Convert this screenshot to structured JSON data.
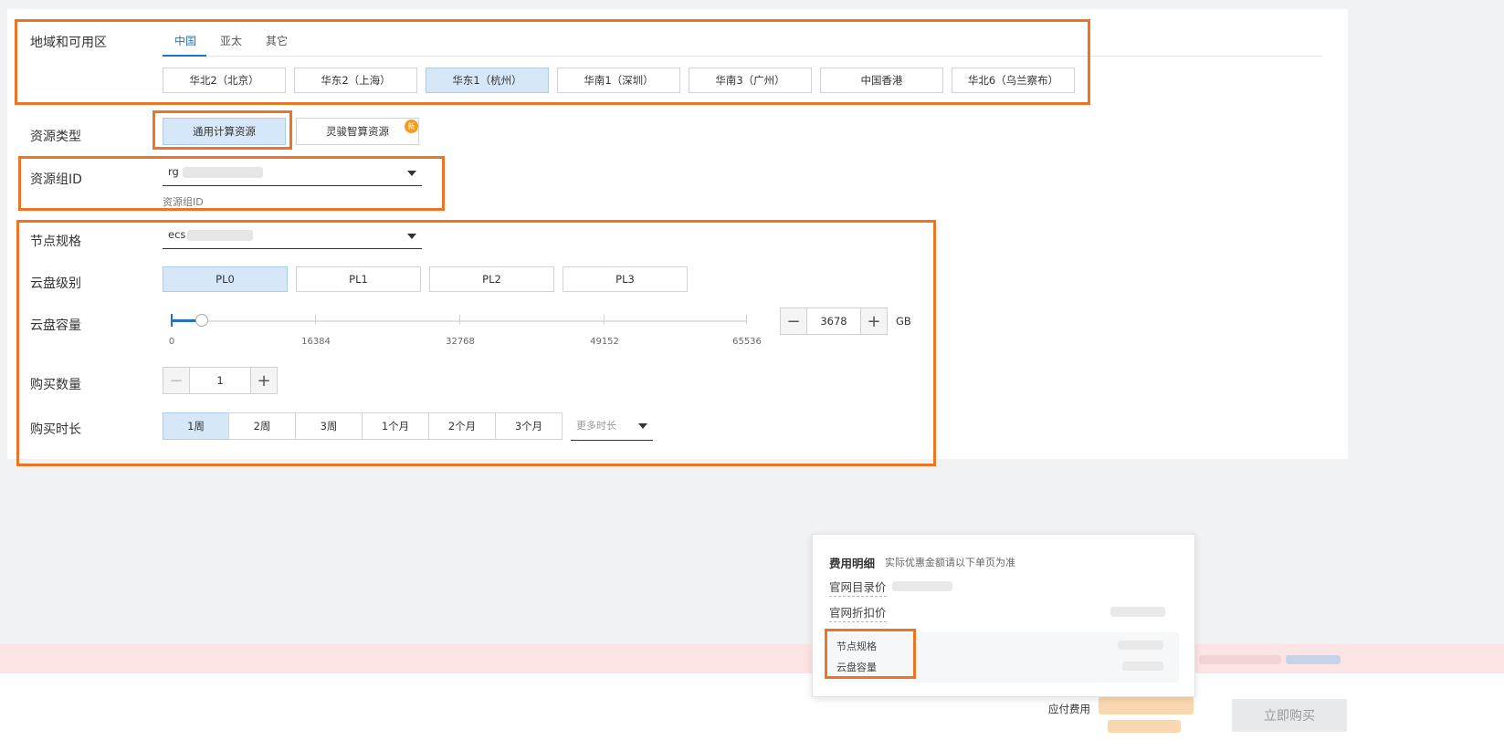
{
  "region": {
    "label": "地域和可用区",
    "tabs": [
      "中国",
      "亚太",
      "其它"
    ],
    "active_tab": "中国",
    "zones": [
      "华北2（北京）",
      "华东2（上海）",
      "华东1（杭州）",
      "华南1（深圳）",
      "华南3（广州）",
      "中国香港",
      "华北6（乌兰察布）"
    ],
    "selected_zone": "华东1（杭州）"
  },
  "resource_type": {
    "label": "资源类型",
    "options": [
      "通用计算资源",
      "灵骏智算资源"
    ],
    "selected": "通用计算资源",
    "new_badge": "新"
  },
  "resource_group": {
    "label": "资源组ID",
    "value_prefix": "rg",
    "helper": "资源组ID"
  },
  "node_spec": {
    "label": "节点规格",
    "value_prefix": "ecs"
  },
  "disk_level": {
    "label": "云盘级别",
    "options": [
      "PL0",
      "PL1",
      "PL2",
      "PL3"
    ],
    "selected": "PL0"
  },
  "disk_capacity": {
    "label": "云盘容量",
    "ticks": [
      "0",
      "16384",
      "32768",
      "49152",
      "65536"
    ],
    "min": 0,
    "max": 65536,
    "value": "3678",
    "unit": "GB"
  },
  "quantity": {
    "label": "购买数量",
    "value": "1"
  },
  "duration": {
    "label": "购买时长",
    "options": [
      "1周",
      "2周",
      "3周",
      "1个月",
      "2个月",
      "3个月"
    ],
    "selected": "1周",
    "more_placeholder": "更多时长"
  },
  "fee_popover": {
    "title": "费用明细",
    "subtitle": "实际优惠金额请以下单页为准",
    "list_price_label": "官网目录价",
    "discount_price_label": "官网折扣价",
    "items": [
      "节点规格",
      "云盘容量"
    ]
  },
  "footer": {
    "fee_label": "应付费用",
    "buy_button": "立即购买"
  },
  "colors": {
    "accent": "#1f73c2",
    "highlight_box": "#ec7424",
    "selected_bg": "#d6e8f8",
    "banner": "#fde4e4"
  }
}
